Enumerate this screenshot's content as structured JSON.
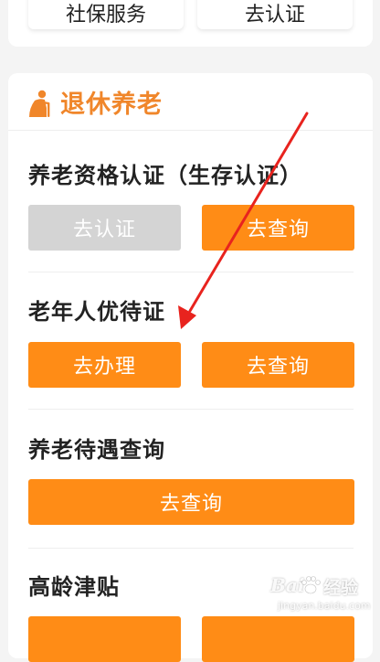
{
  "top_card": {
    "left_button": "社保服务",
    "right_button": "去认证"
  },
  "section": {
    "title": "退休养老",
    "icon": "elderly-person-icon",
    "accent_color": "#f0862a"
  },
  "items": [
    {
      "title": "养老资格认证（生存认证）",
      "buttons": [
        {
          "label": "去认证",
          "state": "disabled"
        },
        {
          "label": "去查询",
          "state": "enabled"
        }
      ]
    },
    {
      "title": "老年人优待证",
      "buttons": [
        {
          "label": "去办理",
          "state": "enabled"
        },
        {
          "label": "去查询",
          "state": "enabled"
        }
      ]
    },
    {
      "title": "养老待遇查询",
      "buttons": [
        {
          "label": "去查询",
          "state": "enabled"
        }
      ]
    },
    {
      "title": "高龄津贴",
      "buttons": []
    }
  ],
  "colors": {
    "button_orange": "#ff8c16",
    "button_disabled": "#d4d4d4",
    "arrow_red": "#e8231e"
  },
  "watermark": {
    "logo": "Bai",
    "text": "经验",
    "url": "jingyan.baidu.com"
  }
}
